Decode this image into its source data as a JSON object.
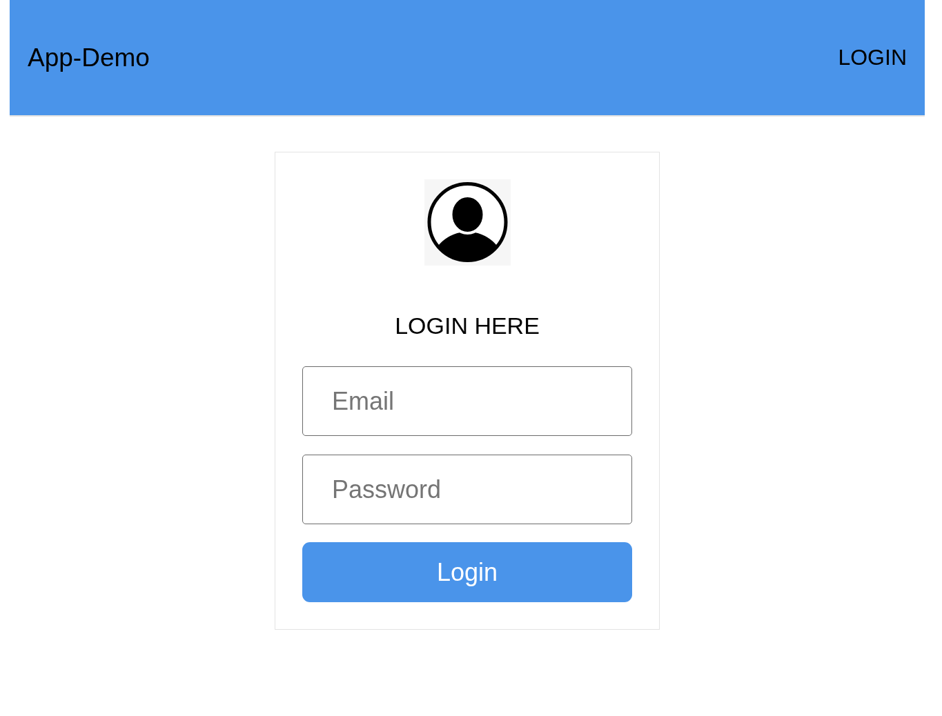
{
  "header": {
    "title": "App-Demo",
    "nav_link": "LOGIN"
  },
  "login_card": {
    "heading": "LOGIN HERE",
    "fields": [
      {
        "placeholder": "Email"
      },
      {
        "placeholder": "Password"
      }
    ],
    "submit_button": "Login"
  }
}
